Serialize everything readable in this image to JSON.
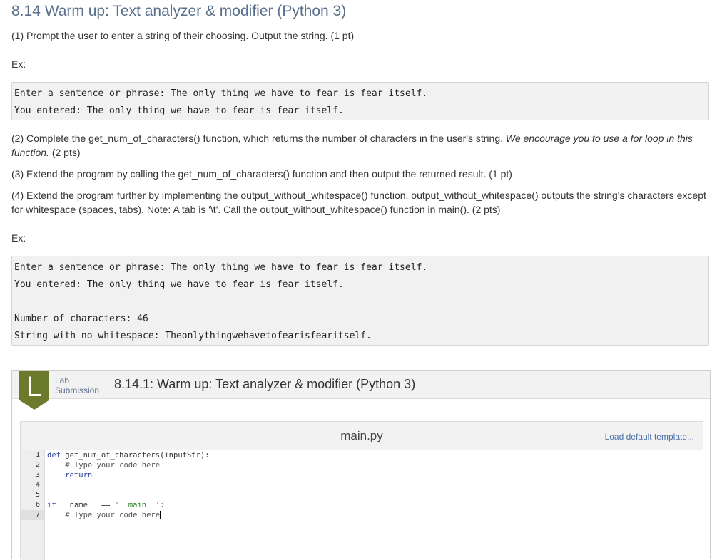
{
  "page": {
    "title": "8.14 Warm up: Text analyzer & modifier (Python 3)"
  },
  "instructions": {
    "p1": "(1) Prompt the user to enter a string of their choosing. Output the string. (1 pt)",
    "ex_label_1": "Ex:",
    "example1": [
      "Enter a sentence or phrase: The only thing we have to fear is fear itself.",
      "You entered: The only thing we have to fear is fear itself."
    ],
    "p2_text": "(2) Complete the get_num_of_characters() function, which returns the number of characters in the user's string. ",
    "p2_italic": "We encourage you to use a for loop in this function.",
    "p2_pts": " (2 pts)",
    "p3": "(3) Extend the program by calling the get_num_of_characters() function and then output the returned result. (1 pt)",
    "p4": "(4) Extend the program further by implementing the output_without_whitespace() function. output_without_whitespace() outputs the string's characters except for whitespace (spaces, tabs). Note: A tab is '\\t'. Call the output_without_whitespace() function in main(). (2 pts)",
    "ex_label_2": "Ex:",
    "example2": [
      "Enter a sentence or phrase: The only thing we have to fear is fear itself.",
      "You entered: The only thing we have to fear is fear itself.",
      "",
      "Number of characters: 46",
      "String with no whitespace: Theonlythingwehavetofearisfearitself."
    ]
  },
  "lab": {
    "badge_letter": "L",
    "type_line1": "Lab",
    "type_line2": "Submission",
    "title": "8.14.1: Warm up: Text analyzer & modifier (Python 3)",
    "badge_color": "#6c7a2c"
  },
  "editor": {
    "file_name": "main.py",
    "load_template_label": "Load default template...",
    "line_numbers": [
      "1",
      "2",
      "3",
      "4",
      "5",
      "6",
      "7"
    ],
    "active_line": "7",
    "lines": {
      "l1_kw": "def",
      "l1_rest": " get_num_of_characters(inputStr):",
      "l2": "    # Type your code here",
      "l3_kw": "    return",
      "l6_kw": "if",
      "l6_mid": " __name__ == ",
      "l6_str": "'__main__'",
      "l6_end": ":",
      "l7": "    # Type your code here"
    }
  }
}
